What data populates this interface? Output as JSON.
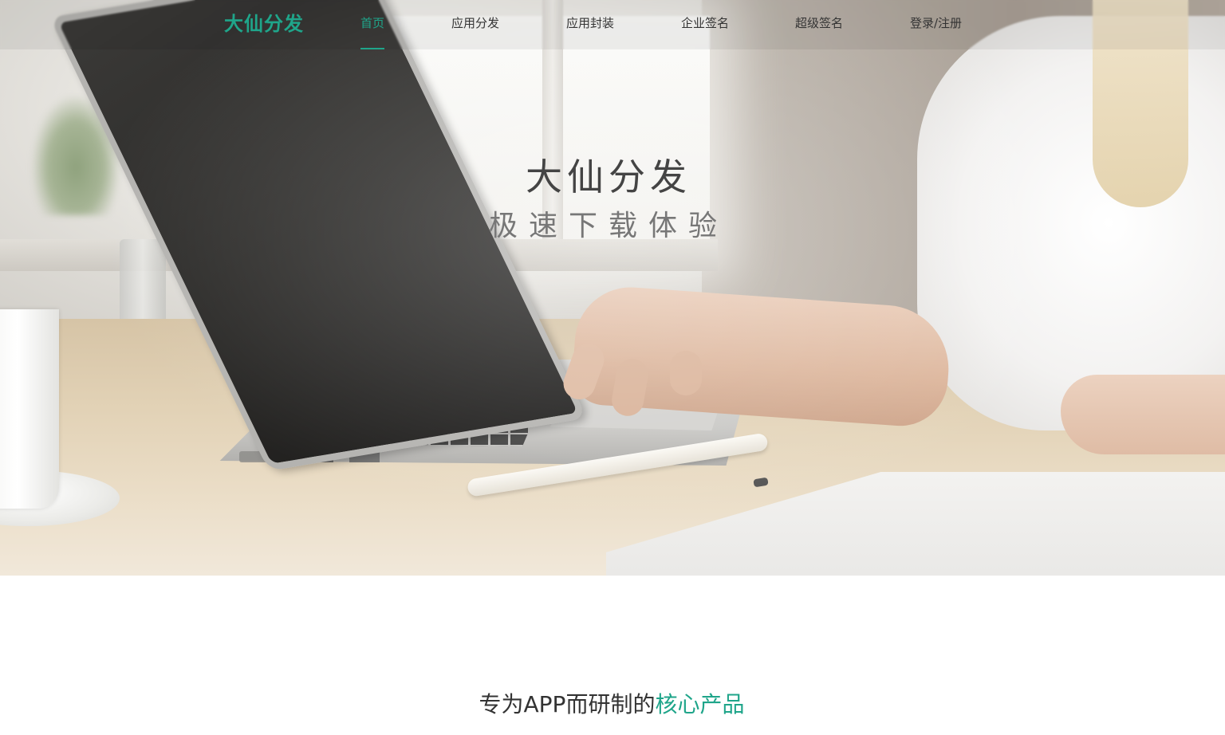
{
  "brand": {
    "logo_text": "大仙分发",
    "accent_color": "#1fa58a"
  },
  "nav": {
    "items": [
      {
        "label": "首页",
        "active": true
      },
      {
        "label": "应用分发",
        "active": false
      },
      {
        "label": "应用封装",
        "active": false
      },
      {
        "label": "企业签名",
        "active": false
      },
      {
        "label": "超级签名",
        "active": false
      },
      {
        "label": "登录/注册",
        "active": false
      }
    ]
  },
  "hero": {
    "title": "大仙分发",
    "subtitle": "极速下载体验"
  },
  "section": {
    "heading_prefix": "专为APP而研制的",
    "heading_accent": "核心产品"
  }
}
